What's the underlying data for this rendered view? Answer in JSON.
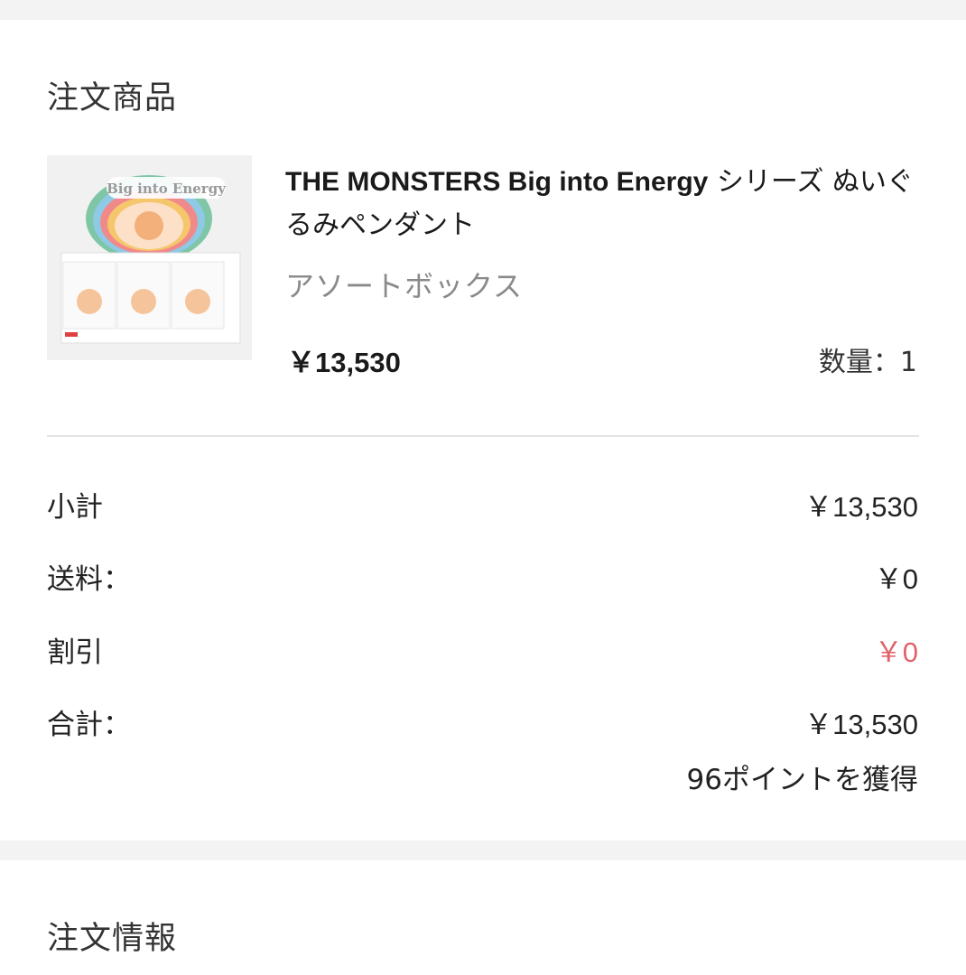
{
  "order_items": {
    "title": "注文商品",
    "product": {
      "name_en": "THE MONSTERS Big into Energy",
      "name_jp": " シリーズ ぬいぐるみペンダント",
      "variant": "アソートボックス",
      "price": "￥13,530",
      "quantity_label": "数量：",
      "quantity": "1",
      "image_alt": "Big into Energy"
    }
  },
  "summary": {
    "subtotal_label": "小計",
    "subtotal_value": "￥13,530",
    "shipping_label": "送料：",
    "shipping_value": "￥0",
    "discount_label": "割引",
    "discount_value": "￥0",
    "total_label": "合計：",
    "total_value": "￥13,530",
    "points": "96ポイントを獲得"
  },
  "order_info": {
    "title": "注文情報"
  },
  "colors": {
    "discount": "#e0636b",
    "divider": "#e4e4e4",
    "section_gap": "#f3f3f3"
  }
}
